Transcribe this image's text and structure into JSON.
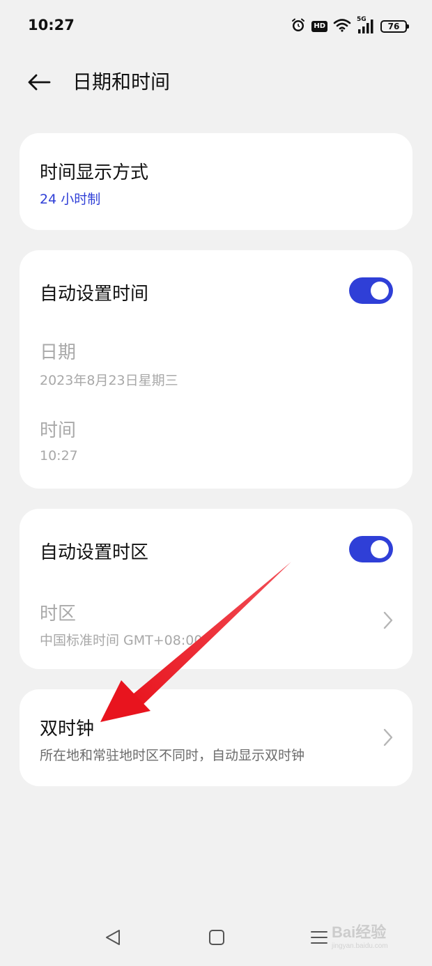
{
  "status_bar": {
    "time": "10:27",
    "network": "5G",
    "hd_label": "HD",
    "battery": "76",
    "icons": [
      "alarm-icon",
      "hd-icon",
      "wifi-icon",
      "signal-icon",
      "battery-icon"
    ]
  },
  "header": {
    "back_icon": "arrow-left-icon",
    "title": "日期和时间"
  },
  "time_format": {
    "title": "时间显示方式",
    "value": "24 小时制"
  },
  "auto_time": {
    "title": "自动设置时间",
    "enabled": true,
    "date_label": "日期",
    "date_value": "2023年8月23日星期三",
    "time_label": "时间",
    "time_value": "10:27"
  },
  "auto_timezone": {
    "title": "自动设置时区",
    "enabled": true,
    "timezone_label": "时区",
    "timezone_value": "中国标准时间 GMT+08:00"
  },
  "dual_clock": {
    "title": "双时钟",
    "subtitle": "所在地和常驻地时区不同时，自动显示双时钟"
  },
  "nav": {
    "icons": [
      "back-triangle-icon",
      "home-square-icon",
      "recents-menu-icon"
    ]
  },
  "watermark": {
    "text": "Bai经验",
    "sub": "jingyan.baidu.com"
  },
  "colors": {
    "accent": "#2f3fd7",
    "background": "#f1f1f1",
    "card": "#ffffff",
    "annotation_arrow": "#e8141e"
  }
}
